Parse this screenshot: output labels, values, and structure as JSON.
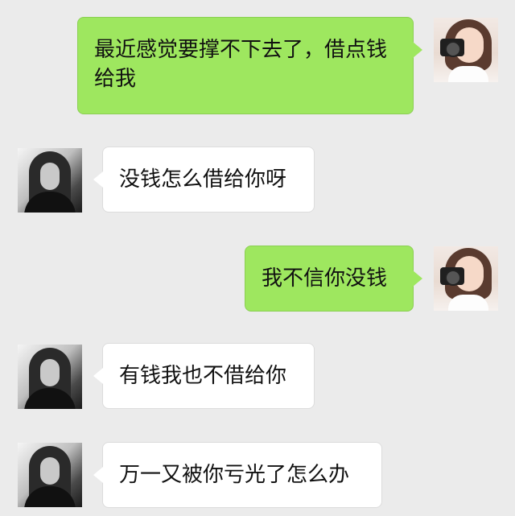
{
  "colors": {
    "background": "#ebebeb",
    "self_bubble": "#9ee75f",
    "other_bubble": "#ffffff"
  },
  "messages": [
    {
      "sender": "self",
      "text": "最近感觉要撑不下去了，借点钱给我"
    },
    {
      "sender": "other",
      "text": "没钱怎么借给你呀"
    },
    {
      "sender": "self",
      "text": "我不信你没钱"
    },
    {
      "sender": "other",
      "text": "有钱我也不借给你"
    },
    {
      "sender": "other",
      "text": "万一又被你亏光了怎么办"
    }
  ]
}
